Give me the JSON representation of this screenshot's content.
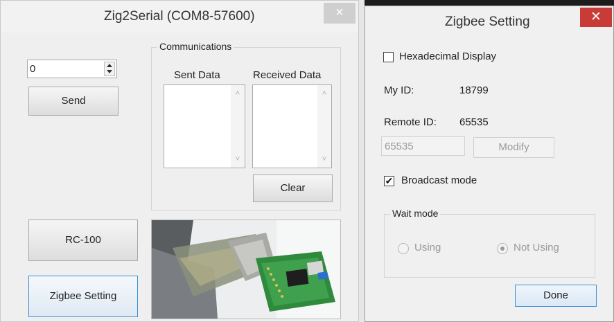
{
  "main_window": {
    "title": "Zig2Serial (COM8-57600)",
    "close_glyph": "×",
    "spinner": {
      "value": "0"
    },
    "send_label": "Send",
    "communications": {
      "legend": "Communications",
      "sent_label": "Sent Data",
      "received_label": "Received Data",
      "clear_label": "Clear"
    },
    "rc_label": "RC-100",
    "zigbee_setting_label": "Zigbee Setting",
    "photo_icon": "usb-zigbee-adapter-photo"
  },
  "settings_window": {
    "title": "Zigbee Setting",
    "close_glyph": "✕",
    "hex_display_label": "Hexadecimal Display",
    "hex_display_checked": false,
    "my_id_label": "My ID:",
    "my_id_value": "18799",
    "remote_id_label": "Remote ID:",
    "remote_id_value": "65535",
    "remote_input_value": "65535",
    "modify_label": "Modify",
    "broadcast_label": "Broadcast mode",
    "broadcast_checked": true,
    "broadcast_glyph": "✔",
    "wait_mode": {
      "legend": "Wait mode",
      "using_label": "Using",
      "not_using_label": "Not Using",
      "selected": "Not Using"
    },
    "done_label": "Done"
  },
  "colors": {
    "close_active": "#c83b36",
    "window_bg": "#f0f0f0",
    "focus_border": "#3b8fd8"
  }
}
